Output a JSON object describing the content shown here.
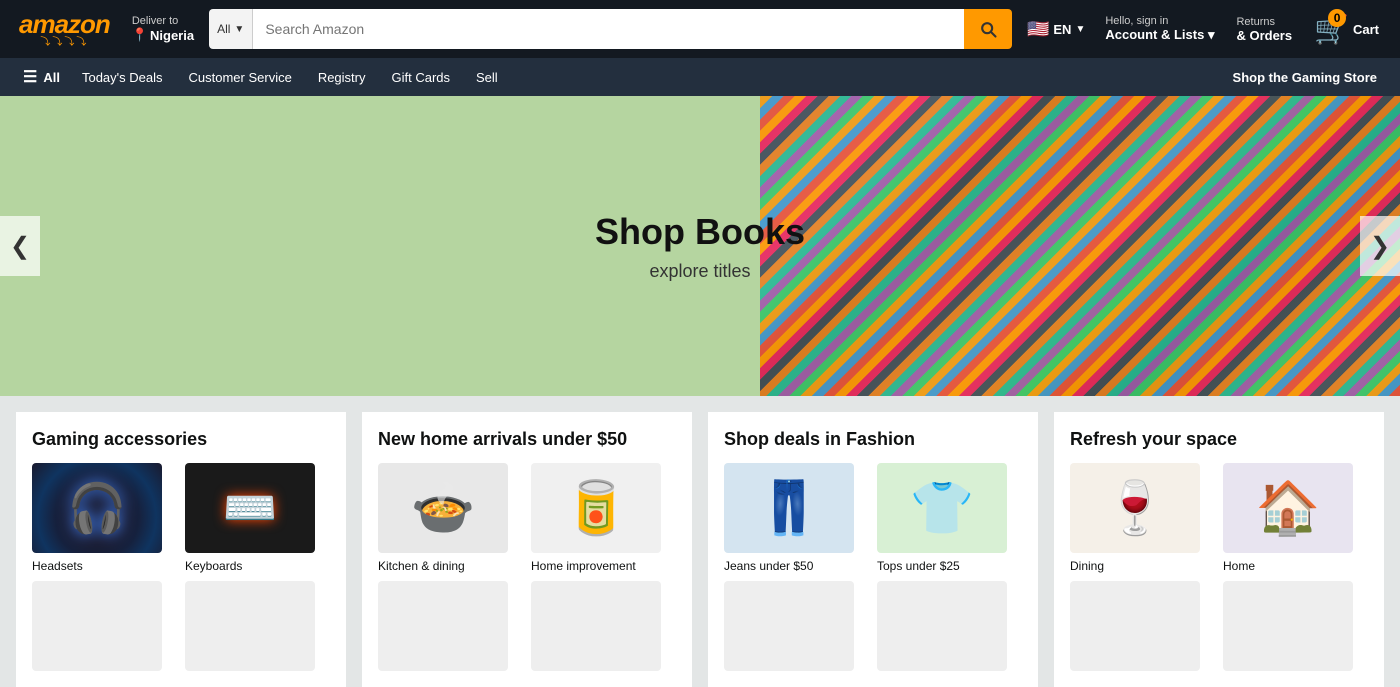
{
  "header": {
    "logo": "amazon",
    "logo_accent": "a",
    "deliver_to": "Deliver to",
    "location": "Nigeria",
    "search_placeholder": "Search Amazon",
    "search_category": "All",
    "lang": "EN",
    "account_top": "Hello, sign in",
    "account_bottom": "Account & Lists",
    "returns_top": "Returns",
    "returns_bottom": "& Orders",
    "cart_count": "0",
    "cart_label": "Cart"
  },
  "navbar": {
    "all": "All",
    "links": [
      {
        "label": "Today's Deals"
      },
      {
        "label": "Customer Service"
      },
      {
        "label": "Registry"
      },
      {
        "label": "Gift Cards"
      },
      {
        "label": "Sell"
      }
    ],
    "promo": "Shop the Gaming Store"
  },
  "hero": {
    "title": "Shop Books",
    "subtitle": "explore titles",
    "prev_arrow": "❮",
    "next_arrow": "❯"
  },
  "cards": [
    {
      "title": "Gaming accessories",
      "items": [
        {
          "label": "Headsets",
          "type": "headset"
        },
        {
          "label": "Keyboards",
          "type": "keyboard"
        },
        {
          "label": "",
          "type": "extra1"
        },
        {
          "label": "",
          "type": "extra2"
        }
      ]
    },
    {
      "title": "New home arrivals under $50",
      "items": [
        {
          "label": "Kitchen & dining",
          "type": "pot"
        },
        {
          "label": "Home improvement",
          "type": "cans"
        },
        {
          "label": "",
          "type": "extra3"
        },
        {
          "label": "",
          "type": "extra4"
        }
      ]
    },
    {
      "title": "Shop deals in Fashion",
      "items": [
        {
          "label": "Jeans under $50",
          "type": "jeans"
        },
        {
          "label": "Tops under $25",
          "type": "tops"
        },
        {
          "label": "",
          "type": "extra5"
        },
        {
          "label": "",
          "type": "extra6"
        }
      ]
    },
    {
      "title": "Refresh your space",
      "items": [
        {
          "label": "Dining",
          "type": "dining"
        },
        {
          "label": "Home",
          "type": "home"
        },
        {
          "label": "",
          "type": "extra7"
        },
        {
          "label": "",
          "type": "extra8"
        }
      ]
    }
  ]
}
